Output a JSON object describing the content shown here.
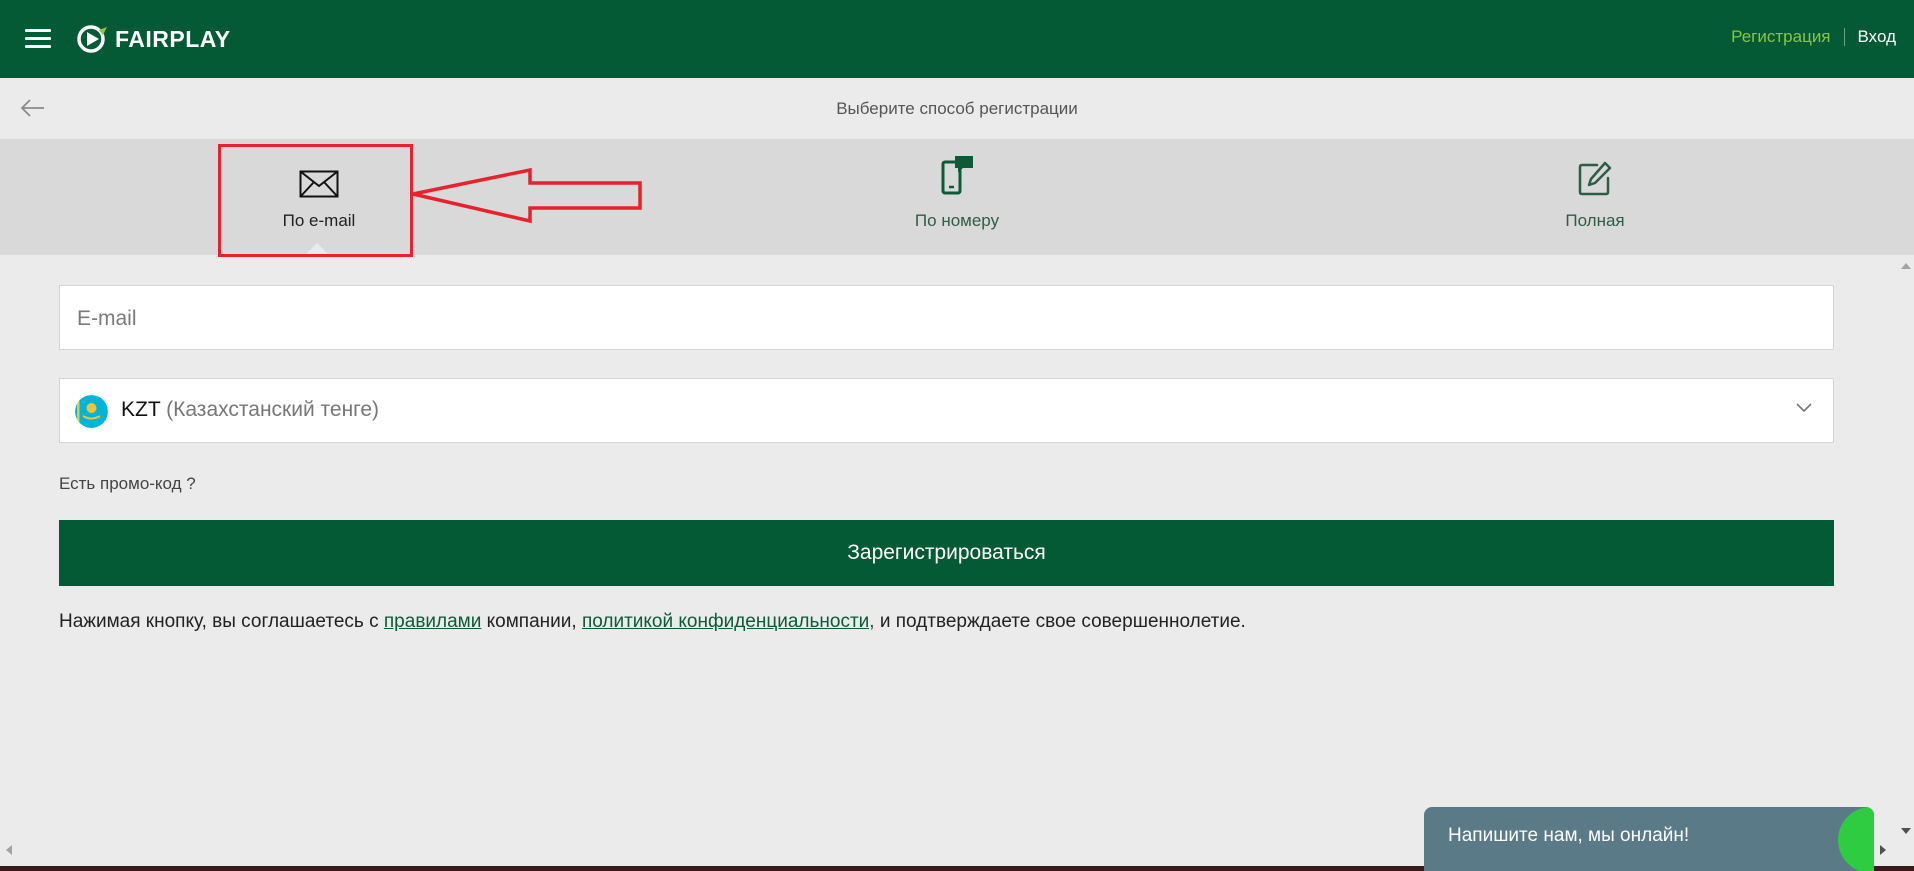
{
  "header": {
    "logo_text": "FAIRPLAY",
    "register_link": "Регистрация",
    "login_link": "Вход"
  },
  "subbar": {
    "title": "Выберите способ регистрации"
  },
  "tabs": [
    {
      "label": "По e-mail",
      "icon": "envelope-icon",
      "active": true
    },
    {
      "label": "По номеру",
      "icon": "phone-chat-icon",
      "active": false
    },
    {
      "label": "Полная",
      "icon": "edit-icon",
      "active": false
    }
  ],
  "form": {
    "email_placeholder": "E-mail",
    "email_value": "",
    "currency_code": "KZT",
    "currency_name": "(Казахстанский тенге)",
    "promo_label": "Есть промо-код ?",
    "submit_label": "Зарегистрироваться"
  },
  "terms": {
    "part1": "Нажимая кнопку, вы соглашаетесь с ",
    "rules_link": "правилами",
    "part2": " компании, ",
    "privacy_link": "политикой конфиденциальности,",
    "part3": " и подтверждаете свое совершеннолетие."
  },
  "chat": {
    "label": "Напишите нам, мы онлайн!"
  },
  "colors": {
    "brand_green": "#035a35",
    "accent_light_green": "#8cc63f",
    "annotation_red": "#e8212b",
    "chat_bg": "#5a7a87"
  }
}
